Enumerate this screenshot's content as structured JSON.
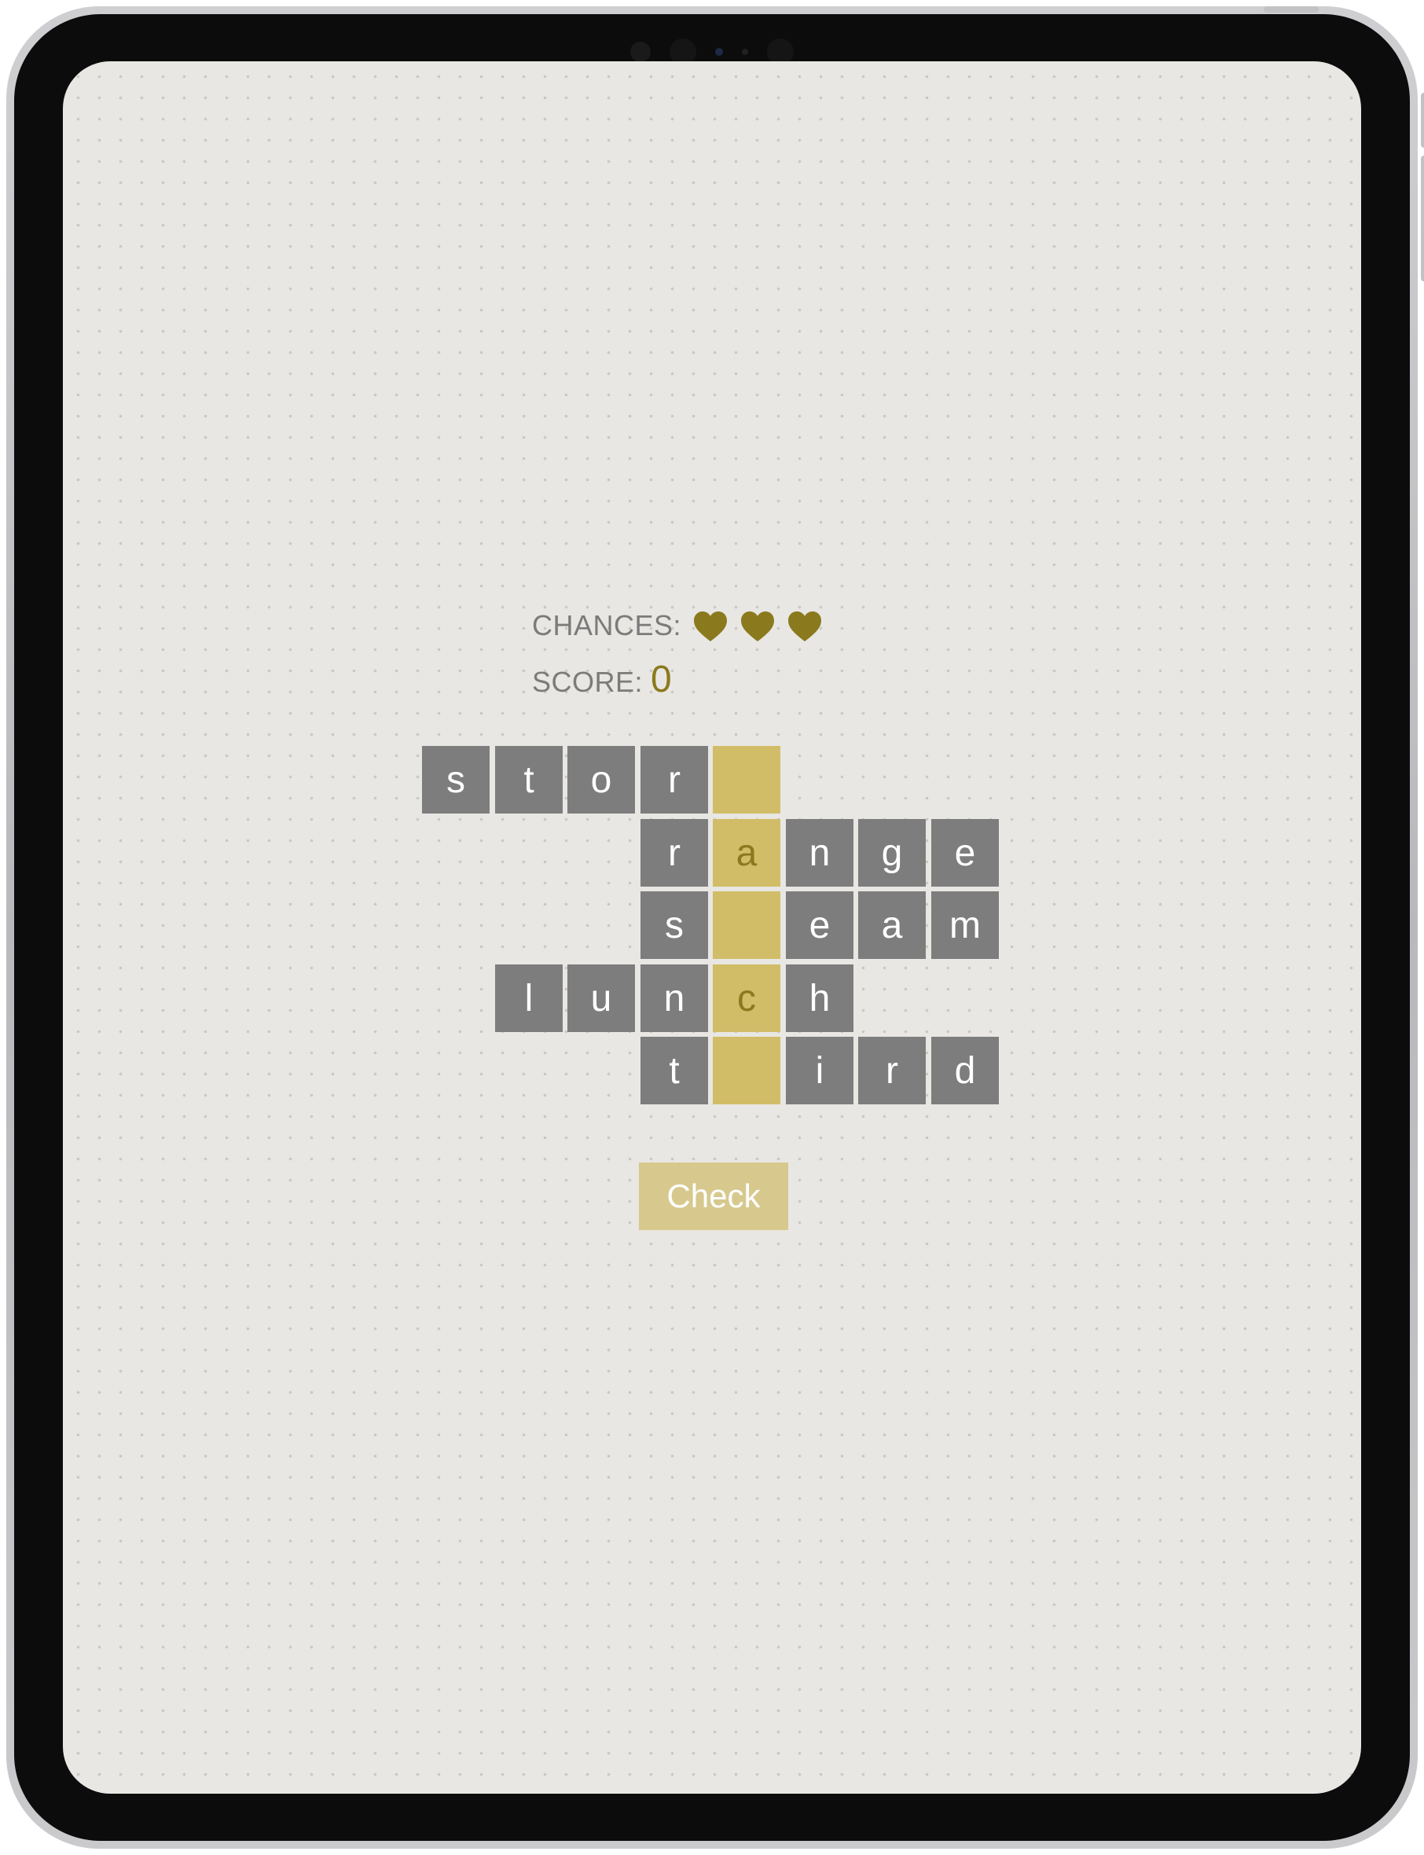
{
  "stats": {
    "chances_label": "CHANCES:",
    "chances_remaining": 3,
    "heart_icon": "heart-icon",
    "heart_color": "#8a7a1d",
    "score_label": "SCORE:",
    "score_value": "0"
  },
  "board": {
    "key_column_color": "#d1bd68",
    "tile_color": "#7d7d7d",
    "rows": [
      {
        "word_tiles": [
          {
            "letter": "s",
            "key": false
          },
          {
            "letter": "t",
            "key": false
          },
          {
            "letter": "o",
            "key": false
          },
          {
            "letter": "r",
            "key": false
          },
          {
            "letter": "",
            "key": true
          }
        ]
      },
      {
        "word_tiles": [
          {
            "letter": "r",
            "key": false
          },
          {
            "letter": "a",
            "key": true
          },
          {
            "letter": "n",
            "key": false
          },
          {
            "letter": "g",
            "key": false
          },
          {
            "letter": "e",
            "key": false
          }
        ]
      },
      {
        "word_tiles": [
          {
            "letter": "s",
            "key": false
          },
          {
            "letter": "",
            "key": true
          },
          {
            "letter": "e",
            "key": false
          },
          {
            "letter": "a",
            "key": false
          },
          {
            "letter": "m",
            "key": false
          }
        ]
      },
      {
        "word_tiles": [
          {
            "letter": "l",
            "key": false
          },
          {
            "letter": "u",
            "key": false
          },
          {
            "letter": "n",
            "key": false
          },
          {
            "letter": "c",
            "key": true
          },
          {
            "letter": "h",
            "key": false
          }
        ]
      },
      {
        "word_tiles": [
          {
            "letter": "t",
            "key": false
          },
          {
            "letter": "",
            "key": true
          },
          {
            "letter": "i",
            "key": false
          },
          {
            "letter": "r",
            "key": false
          },
          {
            "letter": "d",
            "key": false
          }
        ]
      }
    ]
  },
  "actions": {
    "check_label": "Check"
  }
}
